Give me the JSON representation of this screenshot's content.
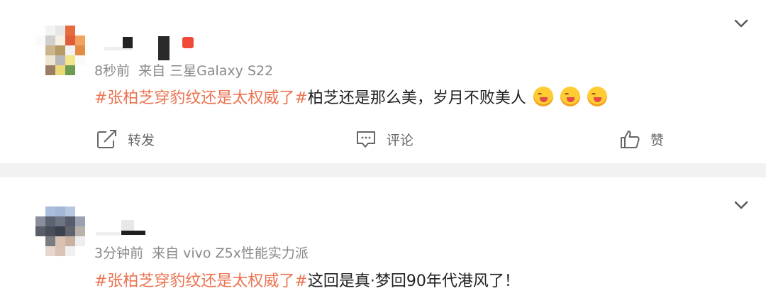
{
  "posts": [
    {
      "meta": {
        "time": "8秒前",
        "source": "来自 三星Galaxy S22"
      },
      "content": {
        "hashtag": "#张柏芝穿豹纹还是太权威了#",
        "text": "柏芝还是那么美，岁月不败美人"
      },
      "emojis": [
        "laughing-emoji",
        "laughing-emoji",
        "laughing-emoji"
      ],
      "actions": {
        "repost": "转发",
        "comment": "评论",
        "like": "赞"
      }
    },
    {
      "meta": {
        "time": "3分钟前",
        "source": "来自 vivo Z5x性能实力派"
      },
      "content": {
        "hashtag": "#张柏芝穿豹纹还是太权威了#",
        "text": "这回是真·梦回90年代港风了！"
      }
    }
  ],
  "colors": {
    "hashtag": "#eb7350",
    "meta": "#8a8a8a",
    "separator": "#f2f2f2"
  },
  "icons": [
    "chevron-down-icon",
    "repost-icon",
    "comment-icon",
    "like-icon"
  ]
}
